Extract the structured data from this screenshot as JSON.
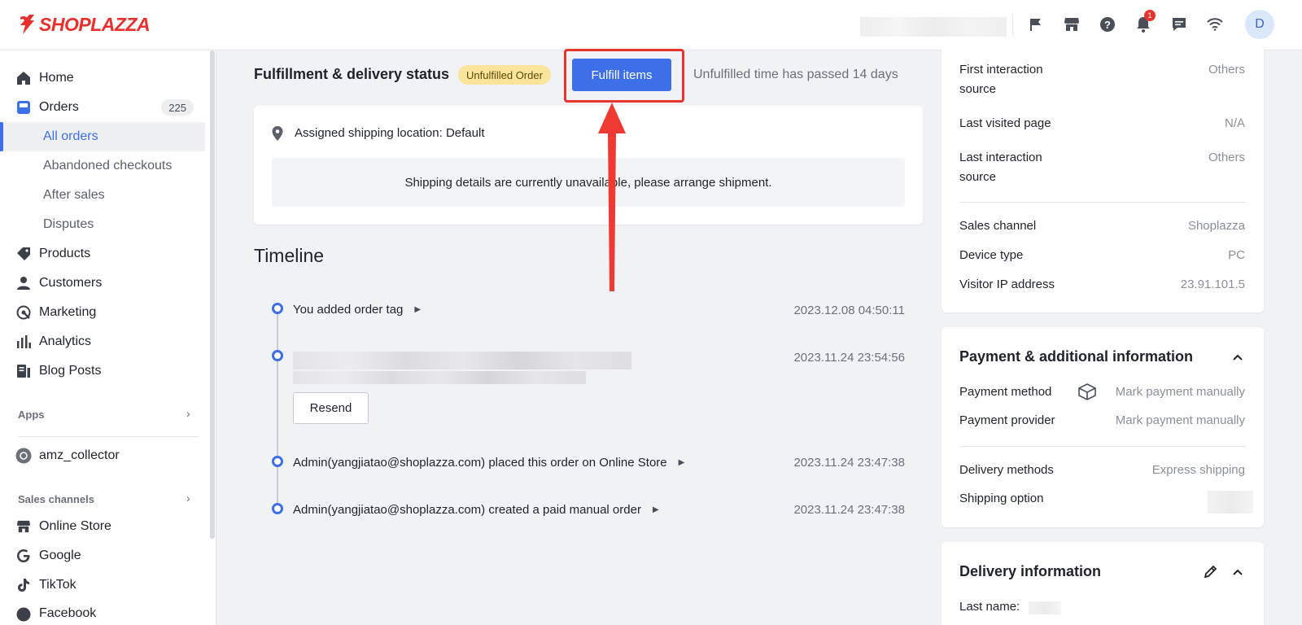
{
  "topbar": {
    "logo_text": "SHOPLAZZA",
    "notification_count": "1",
    "avatar_initial": "D",
    "icons": [
      "flag-icon",
      "store-icon",
      "help-icon",
      "bell-icon",
      "chat-icon",
      "wifi-icon"
    ]
  },
  "sidebar": {
    "home": "Home",
    "orders": "Orders",
    "orders_count": "225",
    "all_orders": "All orders",
    "abandoned": "Abandoned checkouts",
    "after_sales": "After sales",
    "disputes": "Disputes",
    "products": "Products",
    "customers": "Customers",
    "marketing": "Marketing",
    "analytics": "Analytics",
    "blog_posts": "Blog Posts",
    "apps_label": "Apps",
    "app_item": "amz_collector",
    "sales_channels_label": "Sales channels",
    "online_store": "Online Store",
    "google": "Google",
    "tiktok": "TikTok",
    "facebook": "Facebook"
  },
  "fulfillment": {
    "title": "Fulfillment & delivery status",
    "status_badge": "Unfulfilled Order",
    "fulfill_button": "Fulfill items",
    "unfulfilled_time": "Unfulfilled time has passed 14 days",
    "shipping_location": "Assigned shipping location: Default",
    "shipping_note": "Shipping details are currently unavailable, please arrange shipment."
  },
  "timeline": {
    "title": "Timeline",
    "events": [
      {
        "text": "You added order tag",
        "time": "2023.12.08 04:50:11"
      },
      {
        "text": "",
        "time": "2023.11.24 23:54:56",
        "action": "Resend"
      },
      {
        "text": "Admin(yangjiatao@shoplazza.com) placed this order on Online Store",
        "time": "2023.11.24 23:47:38"
      },
      {
        "text": "Admin(yangjiatao@shoplazza.com) created a paid manual order",
        "time": "2023.11.24 23:47:38"
      }
    ]
  },
  "visitor": {
    "first_source_label_1": "First interaction",
    "first_source_label_2": "source",
    "first_source_value": "Others",
    "last_page_label": "Last visited page",
    "last_page_value": "N/A",
    "last_source_label_1": "Last interaction",
    "last_source_label_2": "source",
    "last_source_value": "Others",
    "sales_channel_label": "Sales channel",
    "sales_channel_value": "Shoplazza",
    "device_label": "Device type",
    "device_value": "PC",
    "ip_label": "Visitor IP address",
    "ip_value": "23.91.101.5"
  },
  "payment": {
    "title": "Payment & additional information",
    "method_label": "Payment method",
    "method_value": "Mark payment manually",
    "provider_label": "Payment provider",
    "provider_value": "Mark payment manually",
    "delivery_label": "Delivery methods",
    "delivery_value": "Express shipping",
    "shipping_option_label": "Shipping option"
  },
  "delivery": {
    "title": "Delivery information",
    "last_name_label": "Last name:"
  },
  "colors": {
    "accent": "#3d6fe8",
    "brand": "#e8302f",
    "badge_yellow": "#fce59a",
    "highlight_red": "#e8332f"
  }
}
